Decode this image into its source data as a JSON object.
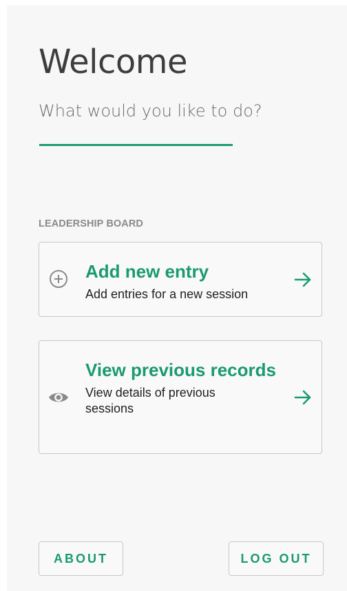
{
  "header": {
    "title": "Welcome",
    "subtitle": "What would you like to do?"
  },
  "section": {
    "label": "LEADERSHIP BOARD"
  },
  "cards": [
    {
      "title": "Add new entry",
      "description": "Add entries for a new session",
      "icon": "add-circle-icon",
      "arrow": "arrow-right-icon"
    },
    {
      "title": "View previous records",
      "description": "View details of previous sessions",
      "icon": "eye-icon",
      "arrow": "arrow-right-icon"
    }
  ],
  "footer": {
    "about_label": "ABOUT",
    "logout_label": "LOG OUT"
  },
  "colors": {
    "accent": "#1a9a72",
    "background": "#f7f7f7",
    "title": "#3d3d3d",
    "muted": "#8a8a8a",
    "border": "#c7c7c7"
  }
}
